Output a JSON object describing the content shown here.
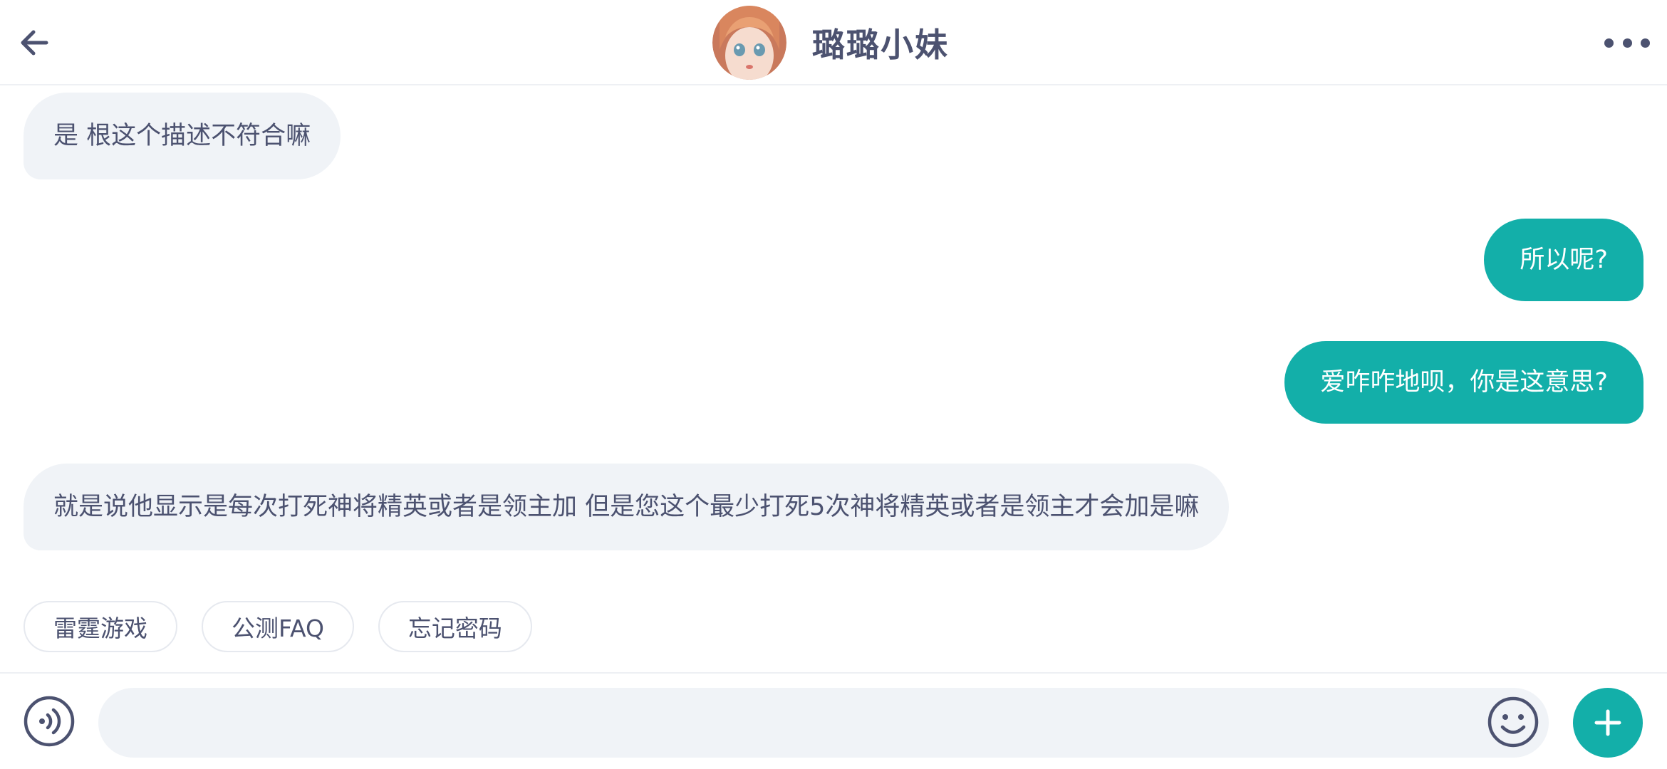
{
  "header": {
    "title": "璐璐小妹",
    "back_icon": "arrow-left-icon",
    "more_icon": "more-horizontal-icon",
    "avatar_alt": "anime-girl-avatar"
  },
  "messages": [
    {
      "direction": "in",
      "text": "是 根这个描述不符合嘛"
    },
    {
      "direction": "out",
      "text": "所以呢?"
    },
    {
      "direction": "out",
      "text": "爱咋咋地呗，你是这意思?"
    },
    {
      "direction": "in",
      "text": "就是说他显示是每次打死神将精英或者是领主加 但是您这个最少打死5次神将精英或者是领主才会加是嘛"
    }
  ],
  "quick_replies": [
    "雷霆游戏",
    "公测FAQ",
    "忘记密码"
  ],
  "input": {
    "value": "",
    "placeholder": "",
    "voice_icon": "voice-icon",
    "emoji_icon": "emoji-smile-icon",
    "plus_icon": "plus-icon"
  },
  "colors": {
    "accent": "#13afa9",
    "text": "#4c5270",
    "bubble_in": "#f0f3f7",
    "divider": "#eef0f4"
  }
}
